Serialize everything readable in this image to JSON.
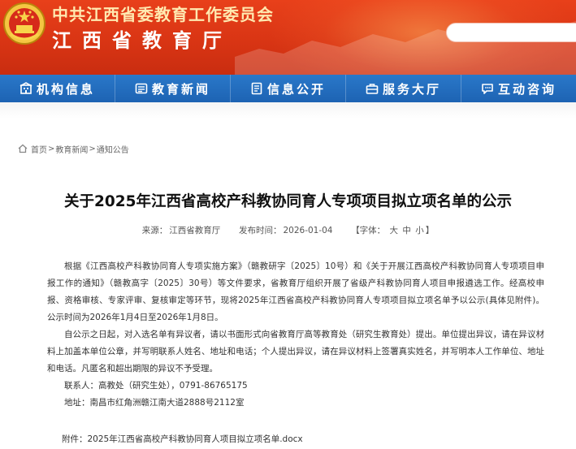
{
  "header": {
    "org_name": "中共江西省委教育工作委员会",
    "dept_name": "江西省教育厅",
    "search_placeholder": ""
  },
  "nav": {
    "items": [
      {
        "label": "机构信息",
        "icon": "building-icon"
      },
      {
        "label": "教育新闻",
        "icon": "news-icon"
      },
      {
        "label": "信息公开",
        "icon": "info-icon"
      },
      {
        "label": "服务大厅",
        "icon": "service-icon"
      },
      {
        "label": "互动咨询",
        "icon": "chat-icon"
      }
    ]
  },
  "breadcrumb": {
    "home": "首页",
    "sep": ">",
    "level1": "教育新闻",
    "level2": "通知公告"
  },
  "article": {
    "title": "关于2025年江西省高校产科教协同育人专项项目拟立项名单的公示",
    "source_label": "来源：",
    "source": "江西省教育厅",
    "date_label": "发布时间：",
    "date": "2026-01-04",
    "font_label": "【字体：",
    "font_large": "大",
    "font_medium": "中",
    "font_small": "小",
    "font_close": "】",
    "para1": "根据《江西高校产科教协同育人专项实施方案》（赣教研字〔2025〕10号）和《关于开展江西高校产科教协同育人专项项目申报工作的通知》（赣教高字〔2025〕30号）等文件要求，省教育厅组织开展了省级产科教协同育人项目申报遴选工作。经高校申报、资格审核、专家评审、复核审定等环节，现将2025年江西省高校产科教协同育人专项项目拟立项名单予以公示(具体见附件)。公示时间为2026年1月4日至2026年1月8日。",
    "para2": "自公示之日起，对入选名单有异议者，请以书面形式向省教育厅高等教育处（研究生教育处）提出。单位提出异议，请在异议材料上加盖本单位公章，并写明联系人姓名、地址和电话；个人提出异议，请在异议材料上签署真实姓名，并写明本人工作单位、地址和电话。凡匿名和超出期限的异议不予受理。",
    "contact": "联系人：高教处（研究生处），0791-86765175",
    "address": "地址：南昌市红角洲赣江南大道2888号2112室",
    "attachment_label": "附件：",
    "attachment": "2025年江西省高校产科教协同育人项目拟立项名单.docx"
  },
  "colors": {
    "header_red": "#d93514",
    "nav_blue": "#1d63b3",
    "header_text_gold": "#ffe9b0"
  }
}
